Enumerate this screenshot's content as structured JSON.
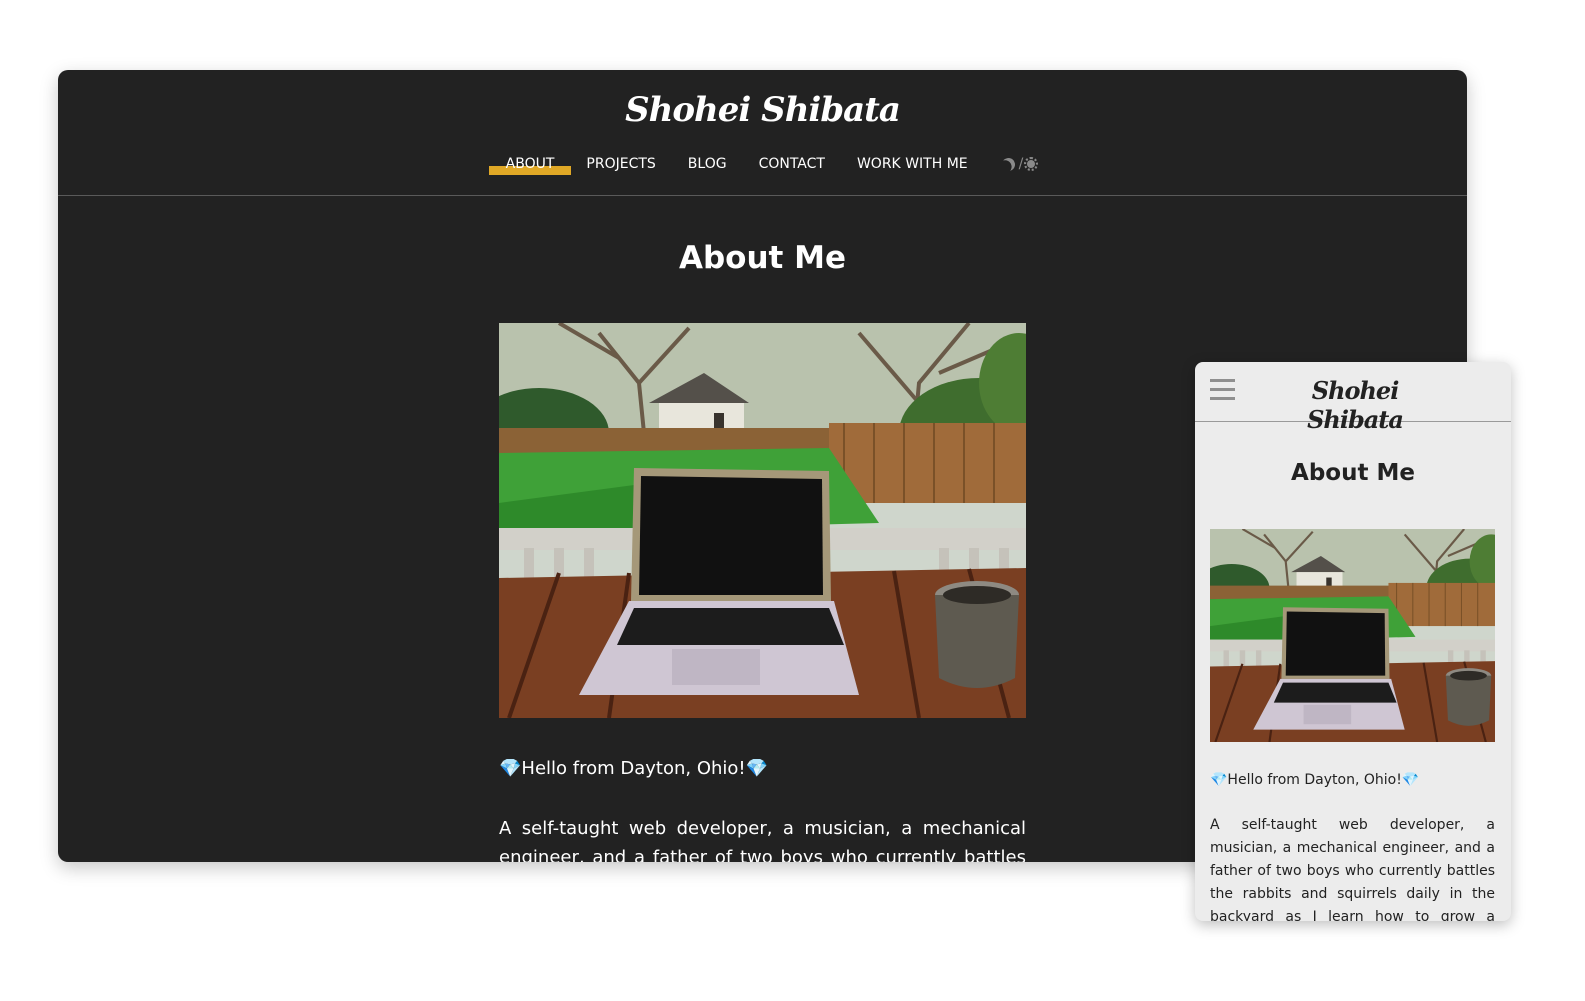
{
  "desktop": {
    "logo": "Shohei Shibata",
    "nav": [
      {
        "label": "ABOUT",
        "active": true
      },
      {
        "label": "PROJECTS"
      },
      {
        "label": "BLOG"
      },
      {
        "label": "CONTACT"
      },
      {
        "label": "WORK WITH ME"
      }
    ],
    "theme_toggle_separator": "/",
    "title": "About Me",
    "hello": "💎Hello from Dayton, Ohio!💎",
    "paragraph": "A self-taught web developer, a musician, a mechanical engineer, and a father of two boys who currently battles the rabbits and squirrels daily in the backyard as I learn how to grow a vegetable garden."
  },
  "mobile": {
    "logo": "Shohei Shibata",
    "title": "About Me",
    "hello": "💎Hello from Dayton, Ohio!💎",
    "paragraph": "A self-taught web developer, a musician, a mechanical engineer, and a father of two boys who currently battles the rabbits and squirrels daily in the backyard as I learn how to grow a vegetable garden. 🌱🐯"
  },
  "colors": {
    "dark_bg": "#222222",
    "light_bg": "#ececec",
    "accent": "#e0a826"
  }
}
